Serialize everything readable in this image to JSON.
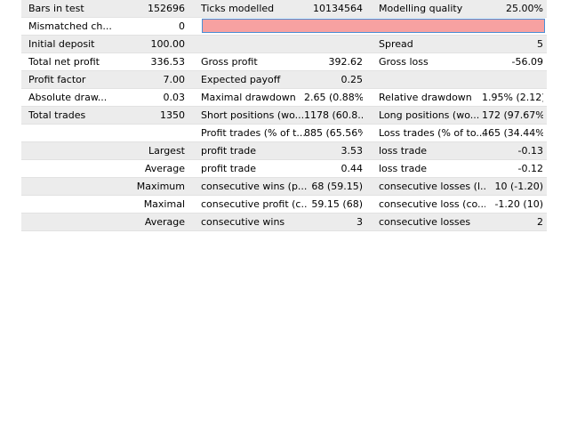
{
  "rows": [
    {
      "shaded": true,
      "cells": [
        {
          "col": 1,
          "align": "l",
          "text": "Bars in test"
        },
        {
          "col": 2,
          "align": "r",
          "text": "152696"
        },
        {
          "col": 3,
          "align": "l",
          "text": "Ticks modelled"
        },
        {
          "col": 4,
          "align": "r",
          "text": "10134564"
        },
        {
          "col": 5,
          "align": "l",
          "text": "Modelling quality"
        },
        {
          "col": 6,
          "align": "r",
          "text": "25.00%"
        }
      ]
    },
    {
      "shaded": false,
      "mismatch_bar": true,
      "cells": [
        {
          "col": 1,
          "align": "l",
          "text": "Mismatched ch..."
        },
        {
          "col": 2,
          "align": "r",
          "text": "0"
        }
      ]
    },
    {
      "shaded": true,
      "cells": [
        {
          "col": 1,
          "align": "l",
          "text": "Initial deposit"
        },
        {
          "col": 2,
          "align": "r",
          "text": "100.00"
        },
        {
          "col": 5,
          "align": "l",
          "text": "Spread"
        },
        {
          "col": 6,
          "align": "r",
          "text": "5"
        }
      ]
    },
    {
      "shaded": false,
      "cells": [
        {
          "col": 1,
          "align": "l",
          "text": "Total net profit"
        },
        {
          "col": 2,
          "align": "r",
          "text": "336.53"
        },
        {
          "col": 3,
          "align": "l",
          "text": "Gross profit"
        },
        {
          "col": 4,
          "align": "r",
          "text": "392.62"
        },
        {
          "col": 5,
          "align": "l",
          "text": "Gross loss"
        },
        {
          "col": 6,
          "align": "r",
          "text": "-56.09"
        }
      ]
    },
    {
      "shaded": true,
      "cells": [
        {
          "col": 1,
          "align": "l",
          "text": "Profit factor"
        },
        {
          "col": 2,
          "align": "r",
          "text": "7.00"
        },
        {
          "col": 3,
          "align": "l",
          "text": "Expected payoff"
        },
        {
          "col": 4,
          "align": "r",
          "text": "0.25"
        }
      ]
    },
    {
      "shaded": false,
      "cells": [
        {
          "col": 1,
          "align": "l",
          "text": "Absolute draw..."
        },
        {
          "col": 2,
          "align": "r",
          "text": "0.03"
        },
        {
          "col": 3,
          "align": "l",
          "text": "Maximal drawdown"
        },
        {
          "col": 4,
          "align": "r",
          "text": "2.65 (0.88%)"
        },
        {
          "col": 5,
          "align": "l",
          "text": "Relative drawdown"
        },
        {
          "col": 6,
          "align": "r",
          "text": "1.95% (2.12)"
        }
      ]
    },
    {
      "shaded": true,
      "cells": [
        {
          "col": 1,
          "align": "l",
          "text": "Total trades"
        },
        {
          "col": 2,
          "align": "r",
          "text": "1350"
        },
        {
          "col": 3,
          "align": "l",
          "text": "Short positions (wo..."
        },
        {
          "col": 4,
          "align": "r",
          "text": "1178 (60.8..."
        },
        {
          "col": 5,
          "align": "l",
          "text": "Long positions (wo..."
        },
        {
          "col": 6,
          "align": "r",
          "text": "172 (97.67%)"
        }
      ]
    },
    {
      "shaded": false,
      "cells": [
        {
          "col": 3,
          "align": "l",
          "text": "Profit trades (% of t..."
        },
        {
          "col": 4,
          "align": "r",
          "text": "885 (65.56%)"
        },
        {
          "col": 5,
          "align": "l",
          "text": "Loss trades (% of to..."
        },
        {
          "col": 6,
          "align": "r",
          "text": "465 (34.44%)"
        }
      ]
    },
    {
      "shaded": true,
      "cells": [
        {
          "col": 2,
          "align": "r",
          "text": "Largest"
        },
        {
          "col": 3,
          "align": "l",
          "text": "profit trade"
        },
        {
          "col": 4,
          "align": "r",
          "text": "3.53"
        },
        {
          "col": 5,
          "align": "l",
          "text": "loss trade"
        },
        {
          "col": 6,
          "align": "r",
          "text": "-0.13"
        }
      ]
    },
    {
      "shaded": false,
      "cells": [
        {
          "col": 2,
          "align": "r",
          "text": "Average"
        },
        {
          "col": 3,
          "align": "l",
          "text": "profit trade"
        },
        {
          "col": 4,
          "align": "r",
          "text": "0.44"
        },
        {
          "col": 5,
          "align": "l",
          "text": "loss trade"
        },
        {
          "col": 6,
          "align": "r",
          "text": "-0.12"
        }
      ]
    },
    {
      "shaded": true,
      "cells": [
        {
          "col": 2,
          "align": "r",
          "text": "Maximum"
        },
        {
          "col": 3,
          "align": "l",
          "text": "consecutive wins (p..."
        },
        {
          "col": 4,
          "align": "r",
          "text": "68 (59.15)"
        },
        {
          "col": 5,
          "align": "l",
          "text": "consecutive losses (l..."
        },
        {
          "col": 6,
          "align": "r",
          "text": "10 (-1.20)"
        }
      ]
    },
    {
      "shaded": false,
      "cells": [
        {
          "col": 2,
          "align": "r",
          "text": "Maximal"
        },
        {
          "col": 3,
          "align": "l",
          "text": "consecutive profit (c..."
        },
        {
          "col": 4,
          "align": "r",
          "text": "59.15 (68)"
        },
        {
          "col": 5,
          "align": "l",
          "text": "consecutive loss (co..."
        },
        {
          "col": 6,
          "align": "r",
          "text": "-1.20 (10)"
        }
      ]
    },
    {
      "shaded": true,
      "cells": [
        {
          "col": 2,
          "align": "r",
          "text": "Average"
        },
        {
          "col": 3,
          "align": "l",
          "text": "consecutive wins"
        },
        {
          "col": 4,
          "align": "r",
          "text": "3"
        },
        {
          "col": 5,
          "align": "l",
          "text": "consecutive losses"
        },
        {
          "col": 6,
          "align": "r",
          "text": "2"
        }
      ]
    }
  ],
  "colors": {
    "shaded_row": "#ececec",
    "mismatch_bar_fill": "#f7a1a1",
    "mismatch_bar_border": "#4a8fd6"
  }
}
